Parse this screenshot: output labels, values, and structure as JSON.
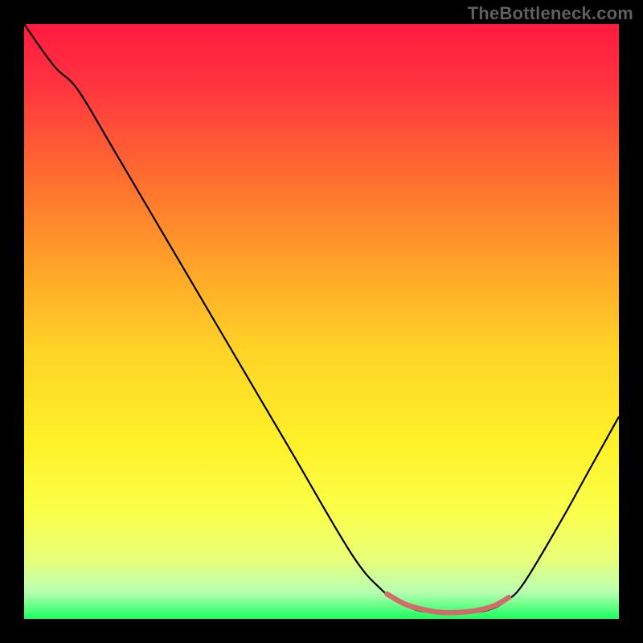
{
  "watermark": "TheBottleneck.com",
  "chart_data": {
    "type": "line",
    "title": "",
    "xlabel": "",
    "ylabel": "",
    "xlim": [
      0,
      100
    ],
    "ylim": [
      0,
      100
    ],
    "grid": false,
    "legend": false,
    "gradient_stops": [
      {
        "offset": 0,
        "color": "#ff1a3f"
      },
      {
        "offset": 0.1,
        "color": "#ff3340"
      },
      {
        "offset": 0.25,
        "color": "#ff6a30"
      },
      {
        "offset": 0.4,
        "color": "#ffa129"
      },
      {
        "offset": 0.55,
        "color": "#ffd427"
      },
      {
        "offset": 0.7,
        "color": "#fff028"
      },
      {
        "offset": 0.82,
        "color": "#fbff4a"
      },
      {
        "offset": 0.9,
        "color": "#e8ff7a"
      },
      {
        "offset": 0.955,
        "color": "#b8ffb2"
      },
      {
        "offset": 0.985,
        "color": "#4fff7a"
      },
      {
        "offset": 1.0,
        "color": "#1aff5c"
      }
    ],
    "series": [
      {
        "name": "curve",
        "color": "#000000",
        "width": 2.2,
        "points": [
          {
            "x": 0,
            "y": 100
          },
          {
            "x": 5,
            "y": 93
          },
          {
            "x": 9,
            "y": 89
          },
          {
            "x": 15,
            "y": 79
          },
          {
            "x": 25,
            "y": 62
          },
          {
            "x": 35,
            "y": 45
          },
          {
            "x": 45,
            "y": 28
          },
          {
            "x": 55,
            "y": 11
          },
          {
            "x": 60,
            "y": 5
          },
          {
            "x": 63,
            "y": 3
          },
          {
            "x": 66,
            "y": 1.5
          },
          {
            "x": 70,
            "y": 1
          },
          {
            "x": 74,
            "y": 1
          },
          {
            "x": 78,
            "y": 1.5
          },
          {
            "x": 81,
            "y": 3
          },
          {
            "x": 84,
            "y": 6
          },
          {
            "x": 90,
            "y": 16
          },
          {
            "x": 95,
            "y": 25
          },
          {
            "x": 100,
            "y": 34
          }
        ]
      },
      {
        "name": "highlight",
        "color": "#d56a6a",
        "width": 6.5,
        "linecap": "round",
        "points": [
          {
            "x": 61,
            "y": 4.2
          },
          {
            "x": 64,
            "y": 2.5
          },
          {
            "x": 67,
            "y": 1.6
          },
          {
            "x": 70,
            "y": 1.1
          },
          {
            "x": 73,
            "y": 1.1
          },
          {
            "x": 76,
            "y": 1.4
          },
          {
            "x": 79,
            "y": 2.2
          },
          {
            "x": 81.5,
            "y": 3.6
          }
        ]
      }
    ]
  }
}
